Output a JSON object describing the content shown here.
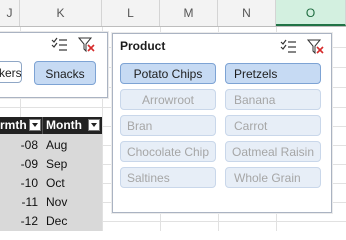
{
  "columns": [
    "J",
    "K",
    "L",
    "M",
    "N",
    "O"
  ],
  "selected_column": "O",
  "left_slicer": {
    "buttons": [
      "kers",
      "Snacks"
    ]
  },
  "table": {
    "headers": [
      "rmth",
      "Month"
    ],
    "rows": [
      {
        "a": "-08",
        "b": "Aug"
      },
      {
        "a": "-09",
        "b": "Sep"
      },
      {
        "a": "-10",
        "b": "Oct"
      },
      {
        "a": "-11",
        "b": "Nov"
      },
      {
        "a": "-12",
        "b": "Dec"
      }
    ]
  },
  "product_slicer": {
    "title": "Product",
    "items": [
      {
        "label": "Potato Chips",
        "selected": true
      },
      {
        "label": "Pretzels",
        "selected": true
      },
      {
        "label": "Arrowroot",
        "selected": false
      },
      {
        "label": "Banana",
        "selected": false
      },
      {
        "label": "Bran",
        "selected": false
      },
      {
        "label": "Carrot",
        "selected": false
      },
      {
        "label": "Chocolate Chip",
        "selected": false
      },
      {
        "label": "Oatmeal Raisin",
        "selected": false
      },
      {
        "label": "Saltines",
        "selected": false
      },
      {
        "label": "Whole Grain",
        "selected": false
      }
    ]
  },
  "icons": [
    "multi-select-icon",
    "clear-filter-icon"
  ],
  "colors": {
    "selected_item": "#c6daf3",
    "unselected_item": "#e7eef7",
    "header_selected": "#d3f0e0",
    "clear_filter_red": "#d62b2b"
  }
}
